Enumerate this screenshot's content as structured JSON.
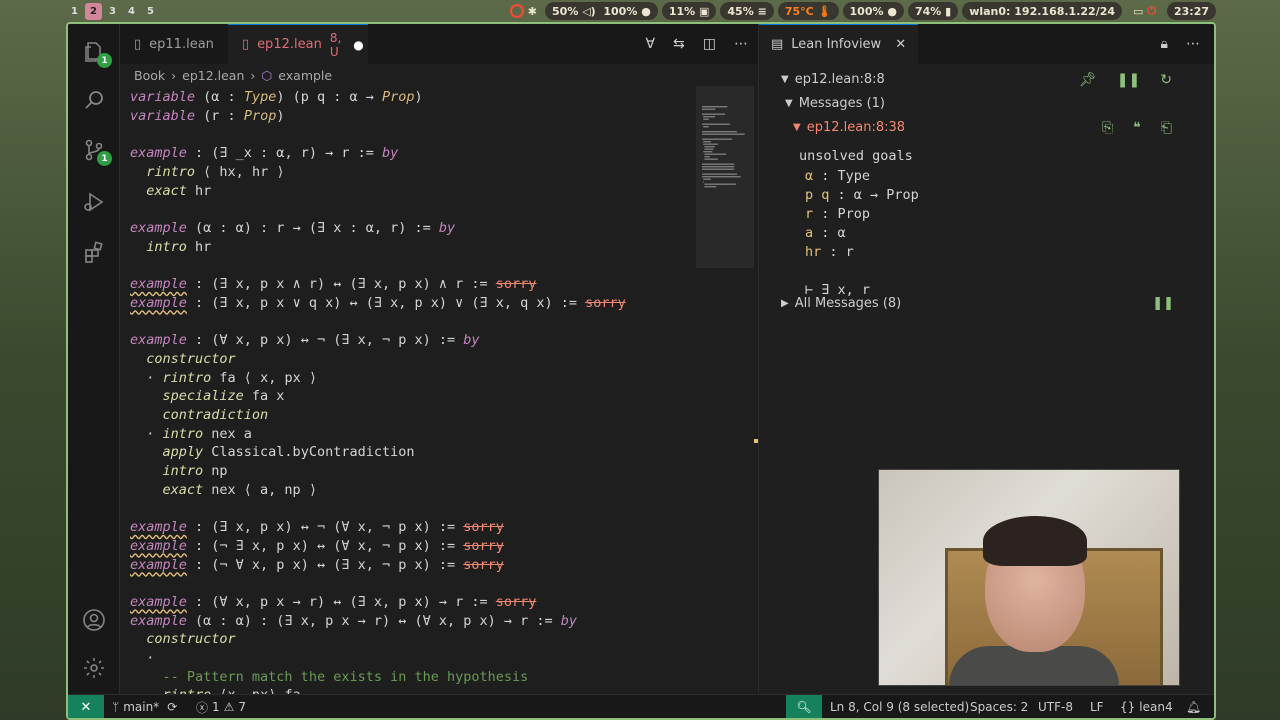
{
  "topbar": {
    "workspaces": [
      "1",
      "2",
      "3",
      "4",
      "5"
    ],
    "active_workspace": "2",
    "audio": "50%",
    "mic": "100%",
    "cpu": "11%",
    "mem": "45%",
    "temp": "75°C",
    "brightness": "100%",
    "battery": "74%",
    "network": "wlan0: 192.168.1.22/24",
    "clock": "23:27"
  },
  "editor": {
    "tabs": [
      {
        "label": "ep11.lean",
        "status": ""
      },
      {
        "label": "ep12.lean",
        "status": "8, U"
      }
    ],
    "breadcrumb": [
      "Book",
      "ep12.lean",
      "example"
    ]
  },
  "code": [
    "variable (α : Type) (p q : α → Prop)",
    "variable (r : Prop)",
    "",
    "example : (∃ _x : α, r) → r := by",
    "  rintro ⟨ hx, hr ⟩",
    "  exact hr",
    "",
    "example (α : α) : r → (∃ x : α, r) := by",
    "  intro hr",
    "",
    "example : (∃ x, p x ∧ r) ↔ (∃ x, p x) ∧ r := sorry",
    "example : (∃ x, p x ∨ q x) ↔ (∃ x, p x) ∨ (∃ x, q x) := sorry",
    "",
    "example : (∀ x, p x) ↔ ¬ (∃ x, ¬ p x) := by",
    "  constructor",
    "  · rintro fa ⟨ x, px ⟩",
    "    specialize fa x",
    "    contradiction",
    "  · intro nex a",
    "    apply Classical.byContradiction",
    "    intro np",
    "    exact nex ⟨ a, np ⟩",
    "",
    "example : (∃ x, p x) ↔ ¬ (∀ x, ¬ p x) := sorry",
    "example : (¬ ∃ x, p x) ↔ (∀ x, ¬ p x) := sorry",
    "example : (¬ ∀ x, p x) ↔ (∃ x, ¬ p x) := sorry",
    "",
    "example : (∀ x, p x → r) ↔ (∃ x, p x) → r := sorry",
    "example (α : α) : (∃ x, p x → r) ↔ (∀ x, p x) → r := by",
    "  constructor",
    "  ·",
    "    -- Pattern match the exists in the hypothesis",
    "    rintro ⟨x, px⟩ fa"
  ],
  "infoview": {
    "tab_label": "Lean Infoview",
    "position": "ep12.lean:8:8",
    "messages_label": "Messages (1)",
    "message_pos": "ep12.lean:8:38",
    "goal_title": "unsolved goals",
    "hyps": [
      {
        "name": "α",
        "type": ": Type"
      },
      {
        "name": "p q",
        "type": ": α → Prop"
      },
      {
        "name": "r",
        "type": ": Prop"
      },
      {
        "name": "a",
        "type": ": α"
      },
      {
        "name": "hr",
        "type": ": r"
      }
    ],
    "goal": "⊢ ∃ x, r",
    "all_messages": "All Messages (8)"
  },
  "statusbar": {
    "branch": "main*",
    "errors": "1",
    "warnings": "7",
    "cursor": "Ln 8, Col 9 (8 selected)",
    "spaces": "Spaces: 2",
    "encoding": "UTF-8",
    "eol": "LF",
    "language": "lean4"
  },
  "colors": {
    "accent_border": "#8ec07c",
    "remote_green": "#16825d",
    "tab_modified": "#e06c75",
    "error_pos": "#f48771"
  }
}
